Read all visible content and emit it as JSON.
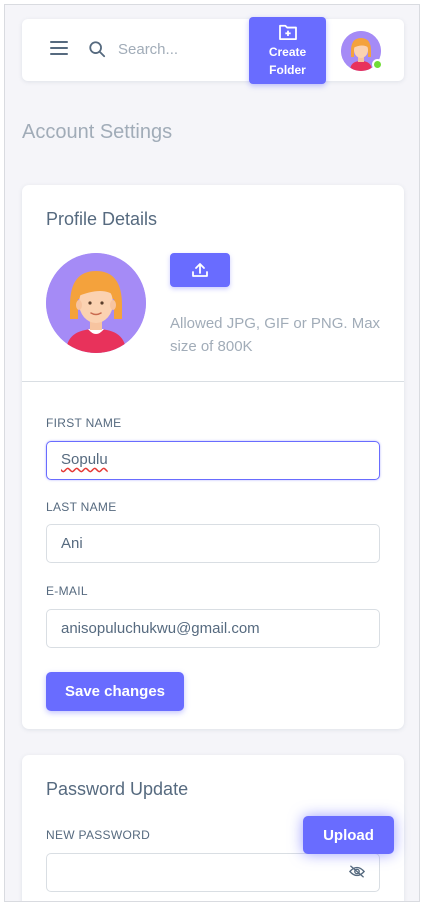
{
  "navbar": {
    "search_placeholder": "Search...",
    "create_folder_label_line1": "Create",
    "create_folder_label_line2": "Folder"
  },
  "page": {
    "title": "Account Settings"
  },
  "profile": {
    "title": "Profile Details",
    "allowed_text": "Allowed JPG, GIF or PNG. Max size of 800K",
    "first_name_label": "FIRST NAME",
    "first_name_value": "Sopulu",
    "last_name_label": "LAST NAME",
    "last_name_value": "Ani",
    "email_label": "E-MAIL",
    "email_value": "anisopuluchukwu@gmail.com",
    "save_label": "Save changes"
  },
  "password": {
    "title": "Password Update",
    "new_password_label": "NEW PASSWORD",
    "new_password_value": ""
  },
  "floating": {
    "upload_label": "Upload"
  },
  "colors": {
    "primary": "#696cff",
    "background": "#f5f5f9",
    "text": "#566a7f",
    "muted": "#a1acb8",
    "online": "#71dd37",
    "avatar_bg": "#a58bf6"
  },
  "icons": {
    "menu": "menu-icon",
    "search": "search-icon",
    "create_folder": "folder-plus-icon",
    "upload": "upload-icon",
    "eye_off": "eye-off-icon"
  }
}
